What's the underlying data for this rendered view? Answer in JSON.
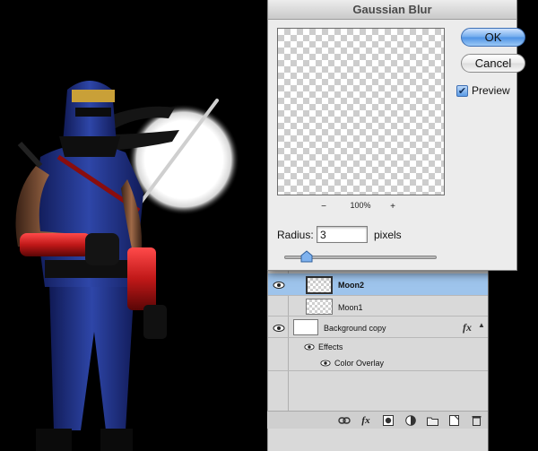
{
  "dialog": {
    "title": "Gaussian Blur",
    "ok_label": "OK",
    "cancel_label": "Cancel",
    "preview_label": "Preview",
    "preview_checked": true,
    "zoom_out": "−",
    "zoom_in": "+",
    "zoom_level": "100%",
    "radius_label": "Radius:",
    "radius_value": "3",
    "radius_unit": "pixels",
    "radius_slider_fraction": 0.03
  },
  "layers": {
    "items": [
      {
        "name": "Moon2",
        "selected": true,
        "visible": true
      },
      {
        "name": "Moon1",
        "selected": false,
        "visible": false
      },
      {
        "name": "Background copy",
        "selected": false,
        "visible": true,
        "fx_label": "fx"
      },
      {
        "name": "Effects",
        "visible": true
      },
      {
        "name": "Color Overlay",
        "visible": true
      }
    ],
    "footer_icons": [
      "link-icon",
      "fx-icon",
      "mask-icon",
      "adjustment-icon",
      "folder-icon",
      "new-layer-icon",
      "trash-icon"
    ],
    "footer_fx_label": "fx"
  },
  "colors": {
    "selection": "#9ec4ec",
    "accent": "#4d92e4",
    "ninja_blue": "#2d3f9a",
    "ninja_red": "#c01818"
  },
  "icons": {
    "visibility": "eye-icon",
    "check": "checkmark-icon",
    "slider": "slider-thumb-icon"
  }
}
